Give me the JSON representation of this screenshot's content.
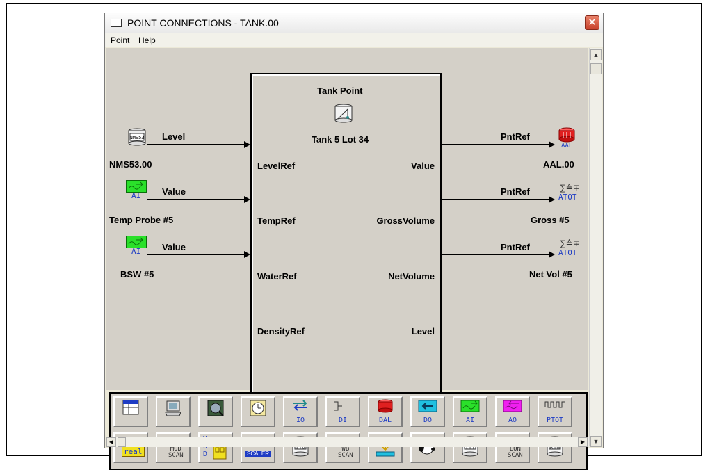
{
  "window": {
    "title": "POINT CONNECTIONS - TANK.00",
    "close_glyph": "✕"
  },
  "menu": {
    "items": [
      "Point",
      "Help"
    ]
  },
  "tank": {
    "header": "Tank Point",
    "name": "Tank 5 Lot 34",
    "inputs": [
      "LevelRef",
      "TempRef",
      "WaterRef",
      "DensityRef"
    ],
    "outputs": [
      "Value",
      "GrossVolume",
      "NetVolume",
      "Level"
    ]
  },
  "left_sources": [
    {
      "icon": "nms53-icon",
      "icon_text": "NMS53",
      "link_label": "Level",
      "name": "NMS53.00"
    },
    {
      "icon": "ai-icon",
      "icon_text": "AI",
      "link_label": "Value",
      "name": "Temp Probe #5"
    },
    {
      "icon": "ai-icon",
      "icon_text": "AI",
      "link_label": "Value",
      "name": "BSW #5"
    }
  ],
  "right_targets": [
    {
      "icon": "aal-icon",
      "icon_text": "AAL",
      "link_label": "PntRef",
      "name": "AAL.00"
    },
    {
      "icon": "atot-icon",
      "icon_text": "ATOT",
      "link_label": "PntRef",
      "name": "Gross #5"
    },
    {
      "icon": "atot-icon",
      "icon_text": "ATOT",
      "link_label": "PntRef",
      "name": "Net Vol #5"
    }
  ],
  "toolbar": {
    "row1": [
      {
        "icon": "table-icon",
        "label": ""
      },
      {
        "icon": "computer-icon",
        "label": ""
      },
      {
        "icon": "circuit-icon",
        "label": ""
      },
      {
        "icon": "clock-icon",
        "label": ""
      },
      {
        "icon": "io-icon",
        "label": "IO"
      },
      {
        "icon": "di-icon",
        "label": "DI"
      },
      {
        "icon": "dal-icon",
        "label": "DAL"
      },
      {
        "icon": "do-icon",
        "label": "DO"
      },
      {
        "icon": "ai-icon",
        "label": "AI"
      },
      {
        "icon": "ao-icon",
        "label": "AO"
      },
      {
        "icon": "ptot-icon",
        "label": "PTOT"
      }
    ],
    "row2": [
      {
        "icon": "mod-real-icon",
        "label": "MOD",
        "sub": "real"
      },
      {
        "icon": "mod-scan-icon",
        "label": "MOD",
        "sub": "SCAN"
      },
      {
        "icon": "mod-icon",
        "label": "MOD",
        "sub": ""
      },
      {
        "icon": "scaler-icon",
        "label": "Ax+B",
        "sub": "SCALER"
      },
      {
        "icon": "itg-icon",
        "label": "ITG",
        "sub": ""
      },
      {
        "icon": "wb-scan-icon",
        "label": "WB",
        "sub": "SCAN"
      },
      {
        "icon": "download-icon",
        "label": "",
        "sub": ""
      },
      {
        "icon": "dog-icon",
        "label": "",
        "sub": ""
      },
      {
        "icon": "itt-icon",
        "label": "ITT",
        "sub": ""
      },
      {
        "icon": "lon-scan-icon",
        "label": "LON",
        "sub": "SCAN"
      },
      {
        "icon": "rtg-icon",
        "label": "RTG",
        "sub": ""
      }
    ]
  },
  "colors": {
    "ai_green": "#2ae02a",
    "ao_magenta": "#f020f0",
    "alarm_red": "#e02020",
    "text_blue": "#1e3cc4"
  }
}
